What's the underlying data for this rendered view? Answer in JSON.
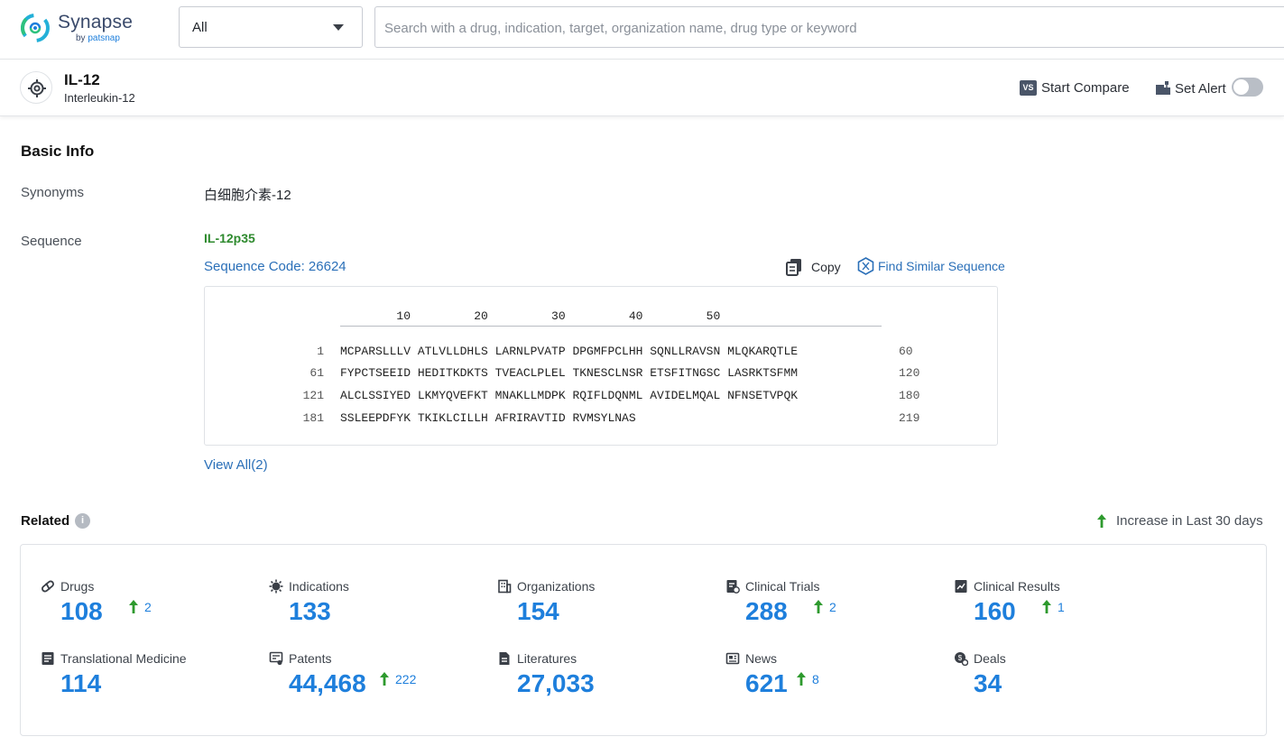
{
  "app": {
    "name": "Synapse",
    "by_prefix": "by",
    "by_brand": "patsnap",
    "brand_color": "#1e7fdc"
  },
  "search": {
    "category": "All",
    "placeholder": "Search with a drug, indication, target, organization name, drug type or keyword",
    "value": ""
  },
  "entity": {
    "icon": "target-icon",
    "title": "IL-12",
    "subtitle": "Interleukin-12",
    "start_compare_label": "Start Compare",
    "compare_icon_text": "VS",
    "set_alert_label": "Set Alert",
    "alert_enabled": false
  },
  "basic_info": {
    "title": "Basic Info",
    "synonyms_label": "Synonyms",
    "synonyms_value": "白细胞介素-12",
    "sequence_label": "Sequence",
    "sequence_name": "IL-12p35",
    "sequence_code_label": "Sequence Code: 26624",
    "copy_label": "Copy",
    "find_similar_label": "Find Similar Sequence",
    "ruler": "        10         20         30         40         50",
    "rows": [
      {
        "start": "1",
        "residues": "MCPARSLLLV ATLVLLDHLS LARNLPVATP DPGMFPCLHH SQNLLRAVSN MLQKARQTLE",
        "end": "60"
      },
      {
        "start": "61",
        "residues": "FYPCTSEEID HEDITKDKTS TVEACLPLEL TKNESCLNSR ETSFITNGSC LASRKTSFMM",
        "end": "120"
      },
      {
        "start": "121",
        "residues": "ALCLSSIYED LKMYQVEFKT MNAKLLMDPK RQIFLDQNML AVIDELMQAL NFNSETVPQK",
        "end": "180"
      },
      {
        "start": "181",
        "residues": "SSLEEPDFYK TKIKLCILLH AFRIRAVTID RVMSYLNAS",
        "end": "219"
      }
    ],
    "view_all_label": "View All(2)"
  },
  "related": {
    "title": "Related",
    "info_glyph": "i",
    "legend_label": "Increase in Last 30 days",
    "increase_color": "#2e9a2e",
    "stats": [
      {
        "key": "drugs",
        "icon": "pill-icon",
        "label": "Drugs",
        "count": "108",
        "increase": "2"
      },
      {
        "key": "indications",
        "icon": "virus-icon",
        "label": "Indications",
        "count": "133",
        "increase": null
      },
      {
        "key": "organizations",
        "icon": "building-icon",
        "label": "Organizations",
        "count": "154",
        "increase": null
      },
      {
        "key": "clinical-trials",
        "icon": "clipboard-icon",
        "label": "Clinical Trials",
        "count": "288",
        "increase": "2"
      },
      {
        "key": "clinical-results",
        "icon": "chart-doc-icon",
        "label": "Clinical Results",
        "count": "160",
        "increase": "1"
      },
      {
        "key": "translational-medicine",
        "icon": "book-icon",
        "label": "Translational Medicine",
        "count": "114",
        "increase": null
      },
      {
        "key": "patents",
        "icon": "patent-icon",
        "label": "Patents",
        "count": "44,468",
        "increase": "222"
      },
      {
        "key": "literatures",
        "icon": "document-icon",
        "label": "Literatures",
        "count": "27,033",
        "increase": null
      },
      {
        "key": "news",
        "icon": "newspaper-icon",
        "label": "News",
        "count": "621",
        "increase": "8"
      },
      {
        "key": "deals",
        "icon": "deal-icon",
        "label": "Deals",
        "count": "34",
        "increase": null
      }
    ]
  }
}
